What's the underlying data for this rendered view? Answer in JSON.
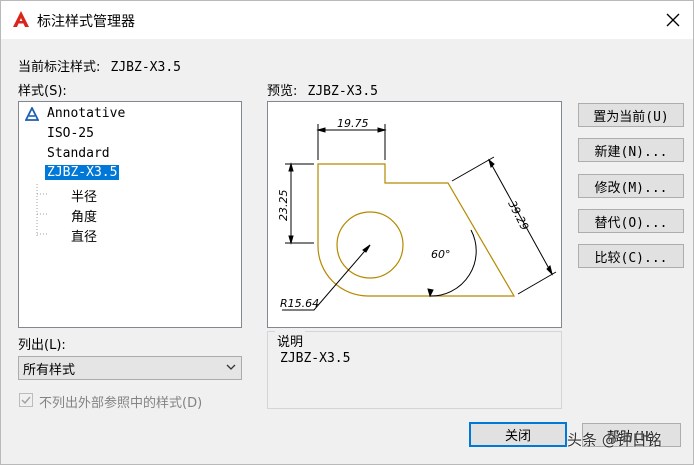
{
  "window": {
    "title": "标注样式管理器",
    "icon": "autocad-logo-icon",
    "close_icon": "close-icon"
  },
  "current_style": {
    "label": "当前标注样式:",
    "value": "ZJBZ-X3.5"
  },
  "styles_label": "样式(S):",
  "styles": [
    {
      "label": "Annotative",
      "icon": "annotative-icon"
    },
    {
      "label": "ISO-25"
    },
    {
      "label": "Standard"
    },
    {
      "label": "ZJBZ-X3.5",
      "selected": true
    },
    {
      "label": "半径",
      "child": true
    },
    {
      "label": "角度",
      "child": true
    },
    {
      "label": "直径",
      "child": true
    }
  ],
  "preview": {
    "label": "预览:",
    "style": "ZJBZ-X3.5",
    "dimensions": {
      "top": "19.75",
      "left": "23.25",
      "diagonal": "39.29",
      "angle": "60°",
      "radius": "R15.64"
    }
  },
  "description": {
    "label": "说明",
    "value": "ZJBZ-X3.5"
  },
  "list_filter": {
    "label": "列出(L):",
    "value": "所有样式"
  },
  "exclude_xref": {
    "label": "不列出外部参照中的样式(D)",
    "checked": true,
    "disabled": true
  },
  "buttons": {
    "set_current": "置为当前(U)",
    "new": "新建(N)...",
    "modify": "修改(M)...",
    "override": "替代(O)...",
    "compare": "比较(C)...",
    "close": "关闭",
    "help": "帮助(H)"
  },
  "watermark": "头条 @钟日铭",
  "colors": {
    "accent": "#0078d7",
    "drawing": "#b58a00"
  }
}
